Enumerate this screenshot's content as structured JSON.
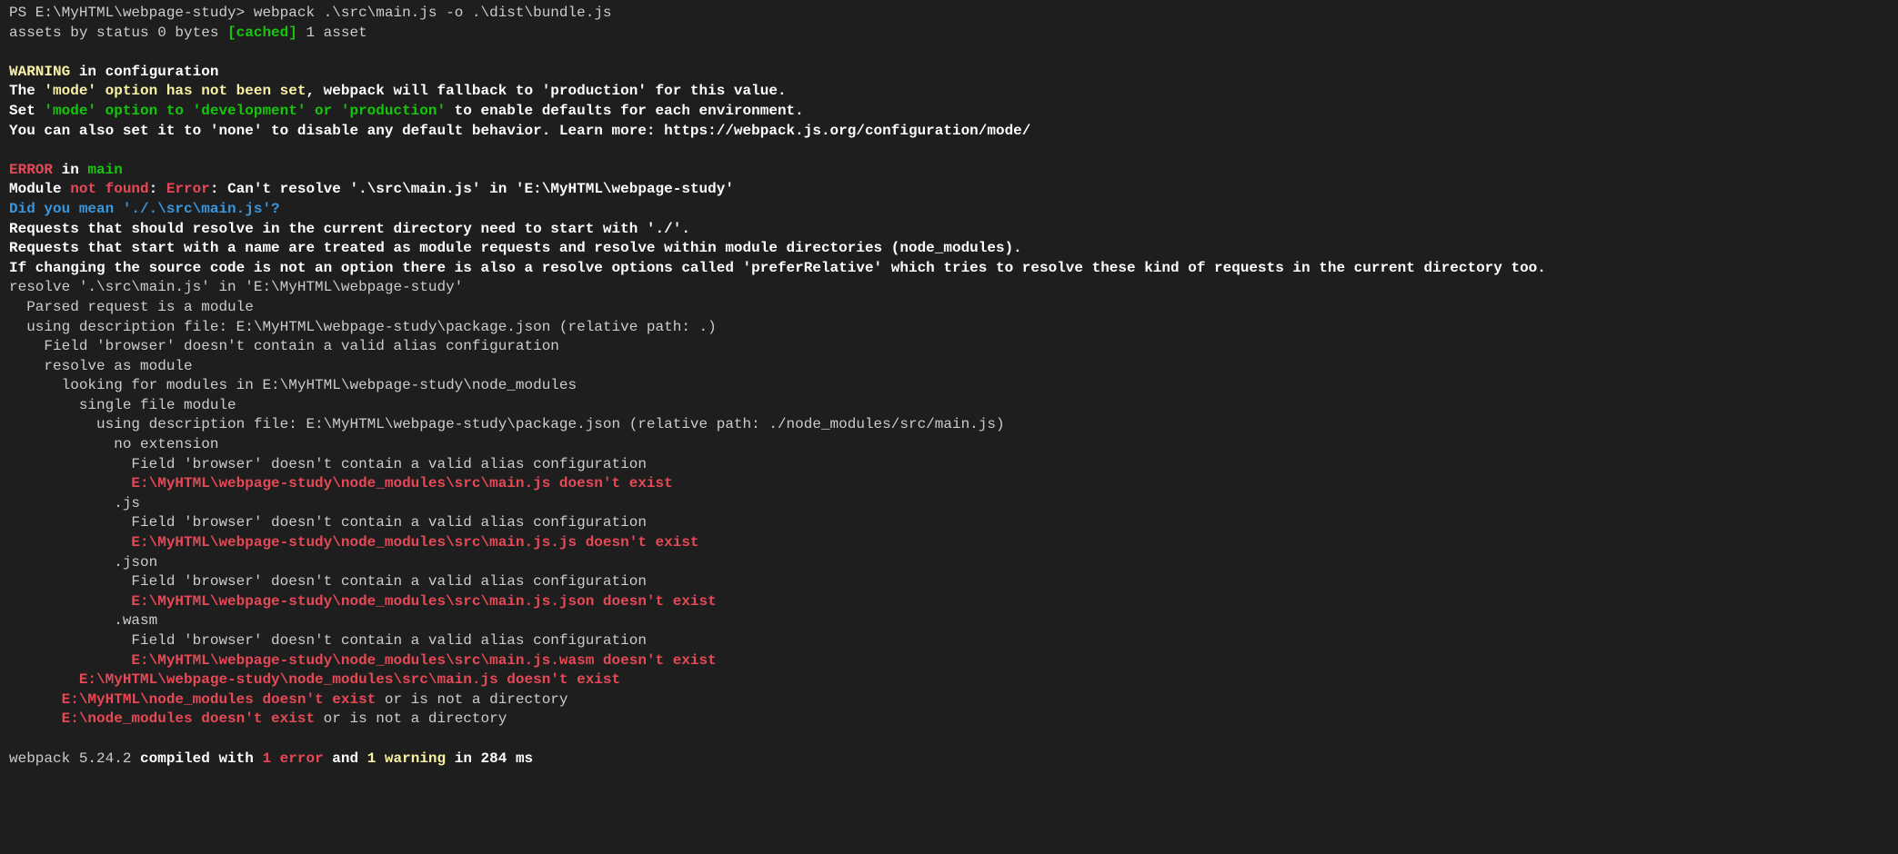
{
  "prompt": {
    "cwd": "PS E:\\MyHTML\\webpage-study>",
    "cmd": " webpack .\\src\\main.js -o .\\dist\\bundle.js"
  },
  "assets": {
    "l1a": "assets by status 0 bytes ",
    "l1b": "[cached]",
    "l1c": " 1 asset"
  },
  "warn": {
    "w1a": "WARNING",
    "w1b": " in ",
    "w1c": "configuration",
    "w2a": "The ",
    "w2b": "'mode' option has not been set",
    "w2c": ", webpack will fallback to 'production' for this value.",
    "w3a": "Set ",
    "w3b": "'mode' option to 'development' or 'production'",
    "w3c": " to enable defaults for each environment.",
    "w4": "You can also set it to 'none' to disable any default behavior. Learn more: https://webpack.js.org/configuration/mode/"
  },
  "err": {
    "e1a": "ERROR",
    "e1b": " in ",
    "e1c": "main",
    "e2a": "Module ",
    "e2b": "not found",
    "e2c": ": ",
    "e2d": "Error",
    "e2e": ": Can't resolve '.\\src\\main.js' in 'E:\\MyHTML\\webpage-study'",
    "e3": "Did you mean './.\\src\\main.js'?",
    "e4": "Requests that should resolve in the current directory need to start with './'.",
    "e5": "Requests that start with a name are treated as module requests and resolve within module directories (node_modules).",
    "e6": "If changing the source code is not an option there is also a resolve options called 'preferRelative' which tries to resolve these kind of requests in the current directory too."
  },
  "res": {
    "r1": "resolve '.\\src\\main.js' in 'E:\\MyHTML\\webpage-study'",
    "r2": "  Parsed request is a module",
    "r3": "  using description file: E:\\MyHTML\\webpage-study\\package.json (relative path: .)",
    "r4": "    Field 'browser' doesn't contain a valid alias configuration",
    "r5": "    resolve as module",
    "r6": "      looking for modules in E:\\MyHTML\\webpage-study\\node_modules",
    "r7": "        single file module",
    "r8": "          using description file: E:\\MyHTML\\webpage-study\\package.json (relative path: ./node_modules/src/main.js)",
    "r9": "            no extension",
    "r10": "              Field 'browser' doesn't contain a valid alias configuration",
    "r11": "              E:\\MyHTML\\webpage-study\\node_modules\\src\\main.js doesn't exist",
    "r12": "            .js",
    "r13": "              Field 'browser' doesn't contain a valid alias configuration",
    "r14": "              E:\\MyHTML\\webpage-study\\node_modules\\src\\main.js.js doesn't exist",
    "r15": "            .json",
    "r16": "              Field 'browser' doesn't contain a valid alias configuration",
    "r17": "              E:\\MyHTML\\webpage-study\\node_modules\\src\\main.js.json doesn't exist",
    "r18": "            .wasm",
    "r19": "              Field 'browser' doesn't contain a valid alias configuration",
    "r20": "              E:\\MyHTML\\webpage-study\\node_modules\\src\\main.js.wasm doesn't exist",
    "r21": "        E:\\MyHTML\\webpage-study\\node_modules\\src\\main.js doesn't exist",
    "r22a": "      E:\\MyHTML\\node_modules doesn't exist",
    "r22b": " or is not a directory",
    "r23a": "      E:\\node_modules doesn't exist",
    "r23b": " or is not a directory"
  },
  "sum": {
    "s1": "webpack 5.24.2 ",
    "s2": "compiled with",
    "s3": " ",
    "s4": "1 error",
    "s5": " and ",
    "s6": "1 warning",
    "s7": " in 284 ms"
  }
}
